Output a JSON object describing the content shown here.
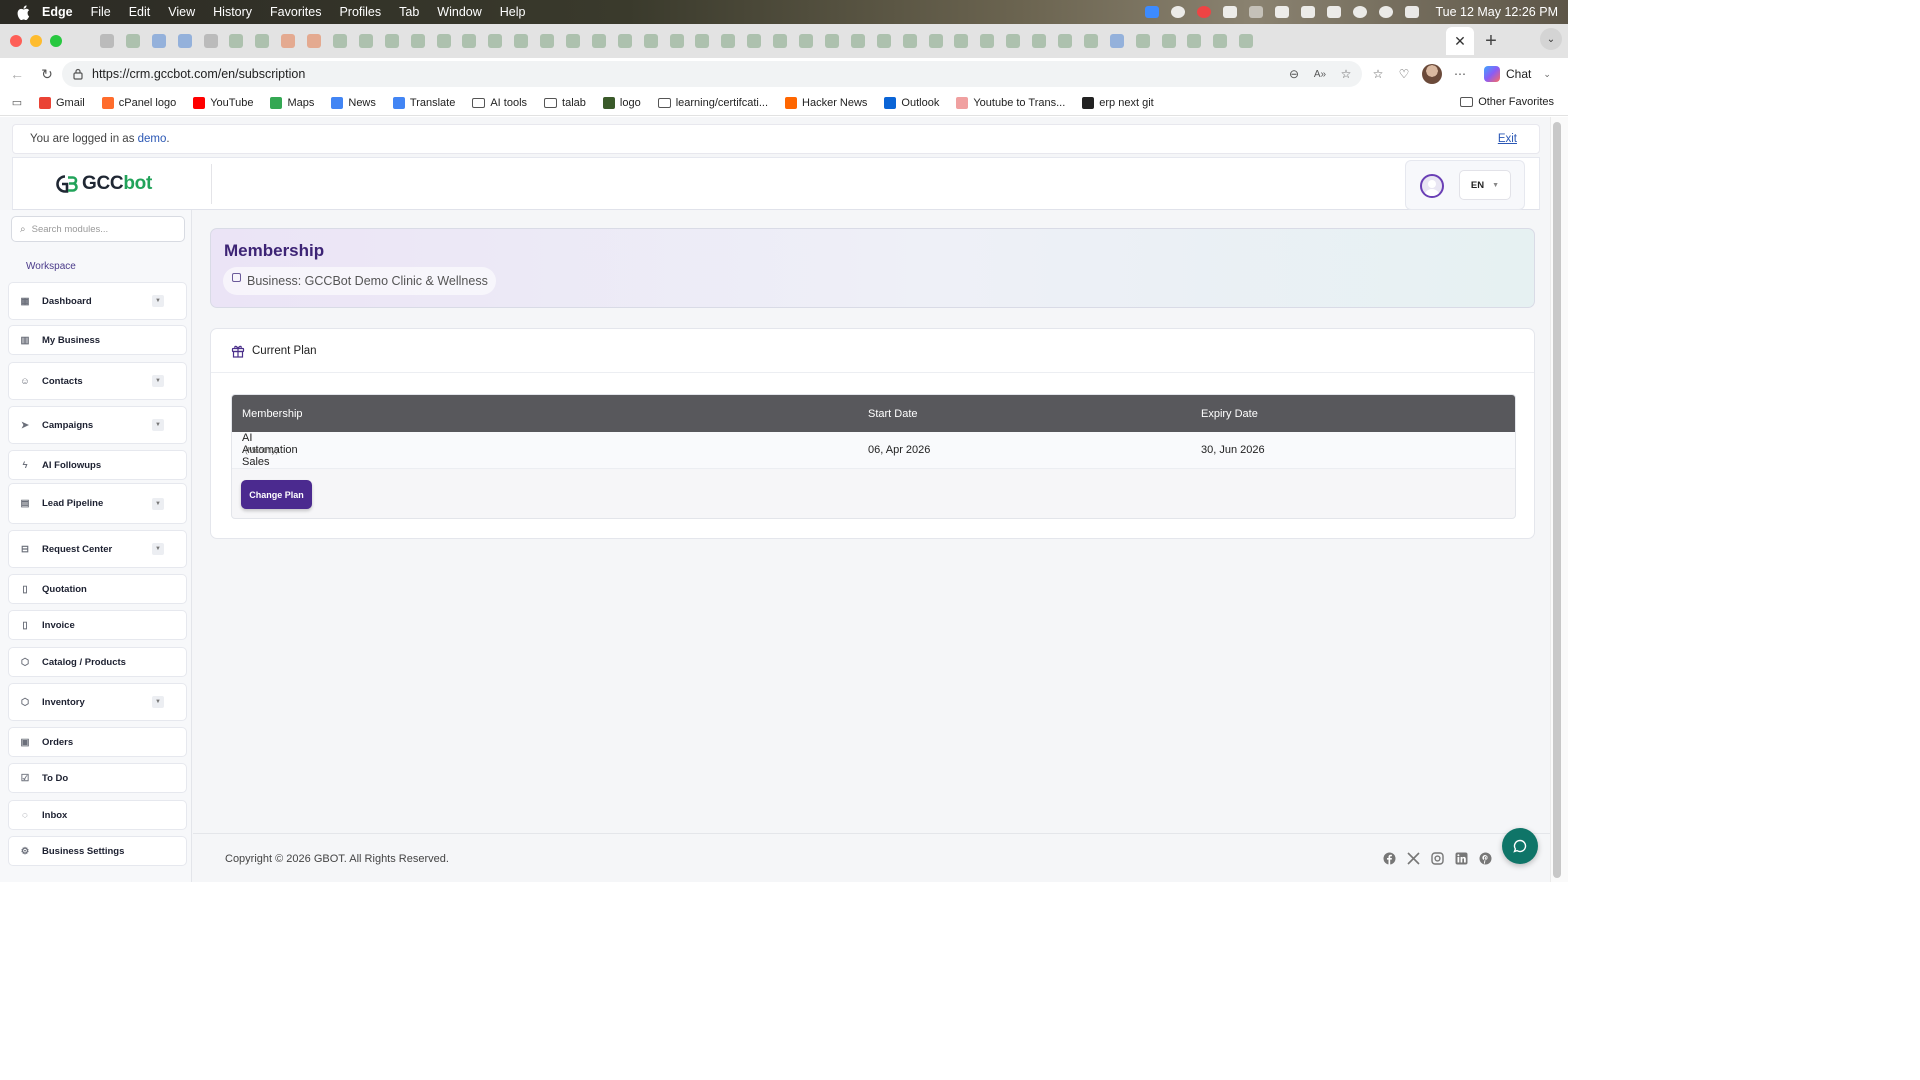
{
  "menubar": {
    "app": "Edge",
    "items": [
      "File",
      "Edit",
      "View",
      "History",
      "Favorites",
      "Profiles",
      "Tab",
      "Window",
      "Help"
    ],
    "datetime": "Tue 12 May  12:26 PM"
  },
  "browser": {
    "url": "https://crm.gccbot.com/en/subscription",
    "chat_label": "Chat",
    "bookmarks": [
      {
        "label": "Gmail",
        "icon": "gmail-icon",
        "color": "#ea4335"
      },
      {
        "label": "cPanel logo",
        "icon": "cpanel-icon",
        "color": "#ff6c2c"
      },
      {
        "label": "YouTube",
        "icon": "youtube-icon",
        "color": "#ff0000"
      },
      {
        "label": "Maps",
        "icon": "maps-icon",
        "color": "#34a853"
      },
      {
        "label": "News",
        "icon": "news-icon",
        "color": "#4285f4"
      },
      {
        "label": "Translate",
        "icon": "translate-icon",
        "color": "#4285f4"
      },
      {
        "label": "AI tools",
        "icon": "folder-icon",
        "color": ""
      },
      {
        "label": "talab",
        "icon": "folder-icon",
        "color": ""
      },
      {
        "label": "logo",
        "icon": "logo-bookmark-icon",
        "color": "#3a5a2a"
      },
      {
        "label": "learning/certifcati...",
        "icon": "folder-icon",
        "color": ""
      },
      {
        "label": "Hacker News",
        "icon": "hacker-news-icon",
        "color": "#ff6600"
      },
      {
        "label": "Outlook",
        "icon": "outlook-icon",
        "color": "#0a64d6"
      },
      {
        "label": "Youtube to Trans...",
        "icon": "transcript-icon",
        "color": "#f0a0a0"
      },
      {
        "label": "erp next git",
        "icon": "github-icon",
        "color": "#222222"
      }
    ],
    "other_favorites": "Other Favorites"
  },
  "session": {
    "prefix": "You are logged in as ",
    "user": "demo",
    "suffix": ".",
    "exit": "Exit"
  },
  "header": {
    "logo_gcc": "GCC",
    "logo_bot": "bot",
    "language": "EN"
  },
  "sidebar": {
    "search_placeholder": "Search modules...",
    "section": "Workspace",
    "items": [
      {
        "label": "Dashboard",
        "icon": "dashboard-grid-icon",
        "expandable": true
      },
      {
        "label": "My Business",
        "icon": "building-icon",
        "expandable": false
      },
      {
        "label": "Contacts",
        "icon": "contacts-icon",
        "expandable": true
      },
      {
        "label": "Campaigns",
        "icon": "send-icon",
        "expandable": true
      },
      {
        "label": "AI Followups",
        "icon": "lightning-icon",
        "expandable": false
      },
      {
        "label": "Lead Pipeline",
        "icon": "briefcase-icon",
        "expandable": true
      },
      {
        "label": "Request Center",
        "icon": "inbox-tray-icon",
        "expandable": true
      },
      {
        "label": "Quotation",
        "icon": "document-dollar-icon",
        "expandable": false
      },
      {
        "label": "Invoice",
        "icon": "document-icon",
        "expandable": false
      },
      {
        "label": "Catalog / Products",
        "icon": "box-icon",
        "expandable": false
      },
      {
        "label": "Inventory",
        "icon": "box-icon",
        "expandable": true
      },
      {
        "label": "Orders",
        "icon": "shopping-bag-icon",
        "expandable": false
      },
      {
        "label": "To Do",
        "icon": "checkbox-icon",
        "expandable": false
      },
      {
        "label": "Inbox",
        "icon": "whatsapp-icon",
        "expandable": false
      },
      {
        "label": "Business Settings",
        "icon": "gear-icon",
        "expandable": false
      }
    ]
  },
  "main": {
    "title": "Membership",
    "business": "Business: GCCBot Demo Clinic & Wellness",
    "card_title": "Current Plan",
    "table": {
      "headers": [
        "Membership",
        "Start Date",
        "Expiry Date"
      ],
      "row": {
        "plan": "AI Automation Sales",
        "period": "(Monthly)",
        "start": "06, Apr 2026",
        "expiry": "30, Jun 2026"
      }
    },
    "change_plan": "Change Plan"
  },
  "footer": {
    "copyright": "Copyright © 2026 GBOT. All Rights Reserved.",
    "socials": [
      "facebook-icon",
      "x-icon",
      "instagram-icon",
      "linkedin-icon",
      "pinterest-icon"
    ]
  },
  "colors": {
    "brand_purple": "#4b2a8f",
    "brand_green": "#22a35a",
    "table_header": "#58585c",
    "chat_fab": "#0f7568"
  }
}
